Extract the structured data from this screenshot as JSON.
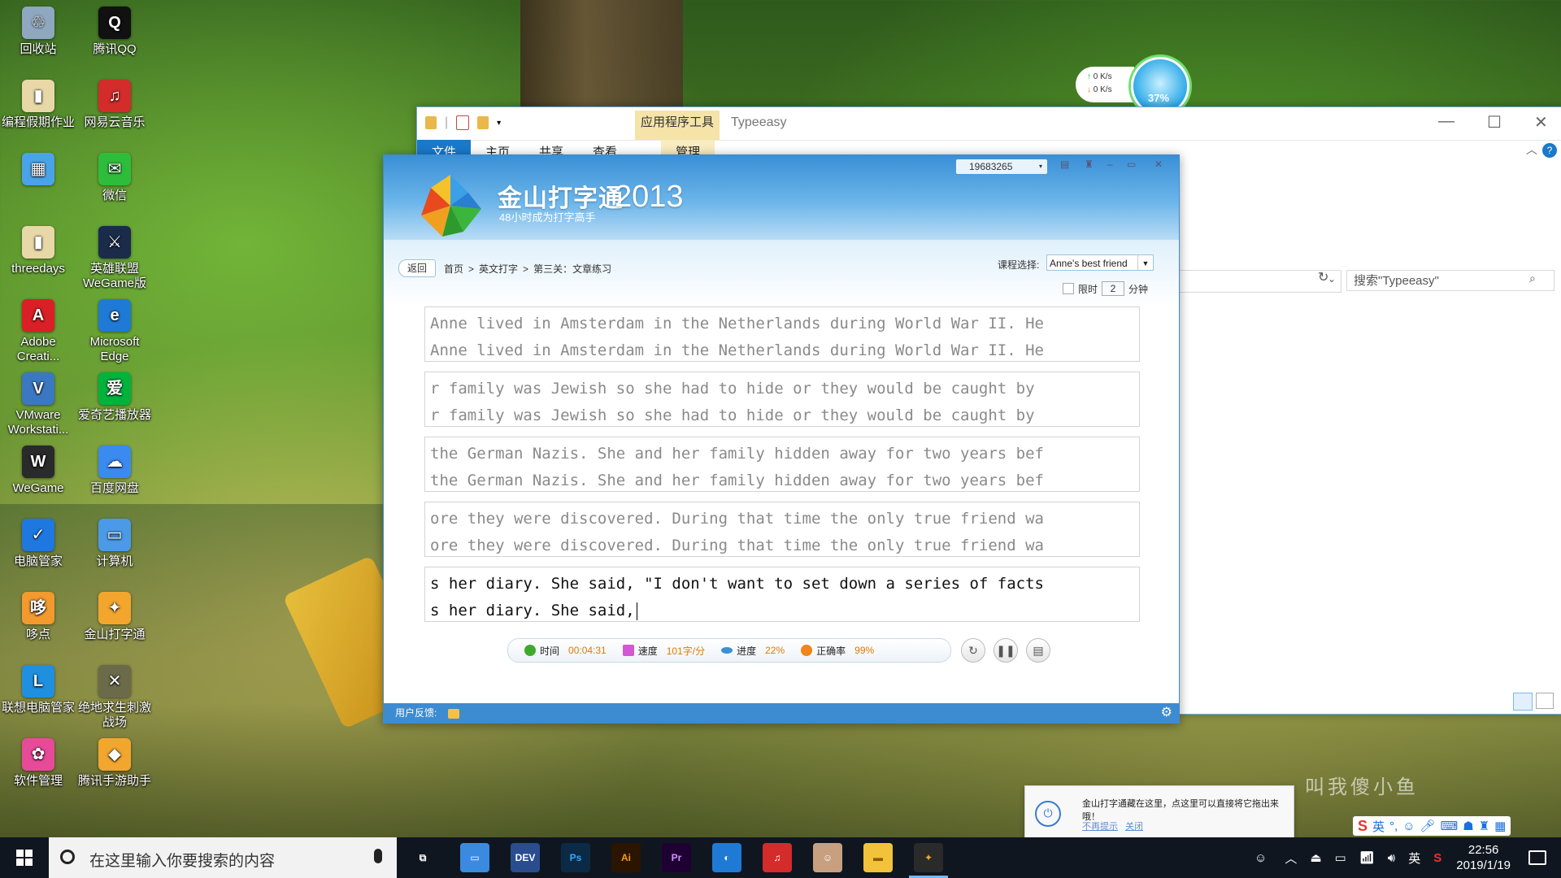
{
  "desktop": {
    "icons": [
      {
        "label": "回收站",
        "color": "#8fa7bf",
        "glyph": "♲"
      },
      {
        "label": "腾讯QQ",
        "color": "#111111",
        "glyph": "Q"
      },
      {
        "label": "编程假期作业",
        "color": "#e8d8a8",
        "glyph": "▮"
      },
      {
        "label": "网易云音乐",
        "color": "#d42b2b",
        "glyph": "♫"
      },
      {
        "label": "",
        "color": "#4aa3e8",
        "glyph": "▦"
      },
      {
        "label": "微信",
        "color": "#2ebd3a",
        "glyph": "✉"
      },
      {
        "label": "threedays",
        "color": "#e8d8a8",
        "glyph": "▮"
      },
      {
        "label": "英雄联盟 WeGame版",
        "color": "#1b2b4a",
        "glyph": "⚔"
      },
      {
        "label": "Adobe Creati...",
        "color": "#da1f26",
        "glyph": "A"
      },
      {
        "label": "Microsoft Edge",
        "color": "#1f7ad6",
        "glyph": "e"
      },
      {
        "label": "VMware Workstati...",
        "color": "#3b78c2",
        "glyph": "V"
      },
      {
        "label": "爱奇艺播放器",
        "color": "#00b33c",
        "glyph": "爱"
      },
      {
        "label": "WeGame",
        "color": "#2a2a2a",
        "glyph": "W"
      },
      {
        "label": "百度网盘",
        "color": "#3a8af0",
        "glyph": "☁"
      },
      {
        "label": "电脑管家",
        "color": "#1f78e0",
        "glyph": "✓"
      },
      {
        "label": "计算机",
        "color": "#4a9ae8",
        "glyph": "▭"
      },
      {
        "label": "哆点",
        "color": "#f29a2e",
        "glyph": "哆"
      },
      {
        "label": "金山打字通",
        "color": "#f2a62e",
        "glyph": "✦"
      },
      {
        "label": "联想电脑管家",
        "color": "#1f90e0",
        "glyph": "L"
      },
      {
        "label": "绝地求生刺激战场",
        "color": "#6b6b4a",
        "glyph": "✕"
      },
      {
        "label": "软件管理",
        "color": "#e84a9a",
        "glyph": "✿"
      },
      {
        "label": "腾讯手游助手",
        "color": "#f2a62e",
        "glyph": "◆"
      }
    ]
  },
  "netwidget": {
    "up": "0  K/s",
    "down": "0  K/s",
    "percent": "37%"
  },
  "explorer": {
    "app_tools": "应用程序工具",
    "title": "Typeeasy",
    "tabs": [
      "文件",
      "主页",
      "共享",
      "查看"
    ],
    "manage_tab": "管理",
    "search_placeholder": "搜索\"Typeeasy\""
  },
  "typing_app": {
    "brand": "金山打字通",
    "year": "2013",
    "slogan": "48小时成为打字高手",
    "user_id": "19683265",
    "back_label": "返回",
    "breadcrumb": [
      "首页",
      ">",
      "英文打字",
      ">",
      "第三关：文章练习"
    ],
    "course_label": "课程选择:",
    "course_value": "Anne's best friend",
    "limit_label": "限时",
    "limit_value": "2",
    "limit_unit": "分钟",
    "lines": [
      {
        "ref": "Anne lived in Amsterdam in the Netherlands during World War II. He",
        "typed": "Anne lived in Amsterdam in the Netherlands during World War II. He",
        "active": false
      },
      {
        "ref": "r family was Jewish so she had to hide or they would be caught by",
        "typed": "r family was Jewish so she had to hide or they would be caught by",
        "active": false
      },
      {
        "ref": "the German Nazis. She and her family hidden away for two years bef",
        "typed": "the German Nazis. She and her family hidden away for two years bef",
        "active": false
      },
      {
        "ref": "ore they were discovered. During that time the only true friend wa",
        "typed": "ore they were discovered. During that time the only true friend wa",
        "active": false
      },
      {
        "ref": "s her diary. She said, \"I don't want to set down a series of facts",
        "typed": "s her diary. She said,",
        "active": true
      }
    ],
    "stats": [
      {
        "label": "时间",
        "value": "00:04:31",
        "color": "#3faa2a"
      },
      {
        "label": "速度",
        "value": "101字/分",
        "color": "#d457d4"
      },
      {
        "label": "进度",
        "value": "22%",
        "color": "#3a8fd6"
      },
      {
        "label": "正确率",
        "value": "99%",
        "color": "#f0851a"
      }
    ],
    "feedback_label": "用户反馈:"
  },
  "toast": {
    "message": "金山打字通藏在这里，点这里可以直接将它拖出来哦！",
    "dont_remind": "不再提示",
    "close": "关闭"
  },
  "watermark": "叫我傻小鱼",
  "ime": {
    "logo": "S",
    "mode": "英"
  },
  "taskbar": {
    "search_placeholder": "在这里输入你要搜索的内容",
    "apps": [
      {
        "name": "task-view",
        "glyph": "⧉",
        "bg": "transparent",
        "fg": "#ffffff"
      },
      {
        "name": "computer",
        "glyph": "▭",
        "bg": "#3a8ae0",
        "fg": "#ffffff"
      },
      {
        "name": "dev-cpp",
        "glyph": "DEV",
        "bg": "#2a4d8f",
        "fg": "#ffffff"
      },
      {
        "name": "photoshop",
        "glyph": "Ps",
        "bg": "#0b2a45",
        "fg": "#31a8ff"
      },
      {
        "name": "illustrator",
        "glyph": "Ai",
        "bg": "#2b1500",
        "fg": "#ff9a00"
      },
      {
        "name": "premiere",
        "glyph": "Pr",
        "bg": "#1f0032",
        "fg": "#d291ff"
      },
      {
        "name": "browser",
        "glyph": "◐",
        "bg": "#1f7ad6",
        "fg": "#ffffff"
      },
      {
        "name": "netease-music",
        "glyph": "♫",
        "bg": "#d42b2b",
        "fg": "#ffffff"
      },
      {
        "name": "avatar-app",
        "glyph": "☺",
        "bg": "#c8a080",
        "fg": "#ffffff"
      },
      {
        "name": "file-explorer",
        "glyph": "▬",
        "bg": "#f2c23a",
        "fg": "#8a5a00"
      },
      {
        "name": "typeeasy",
        "glyph": "✦",
        "bg": "#2a2a2a",
        "fg": "#f2a62e"
      }
    ],
    "lang": "英",
    "time": "22:56",
    "date": "2019/1/19"
  }
}
